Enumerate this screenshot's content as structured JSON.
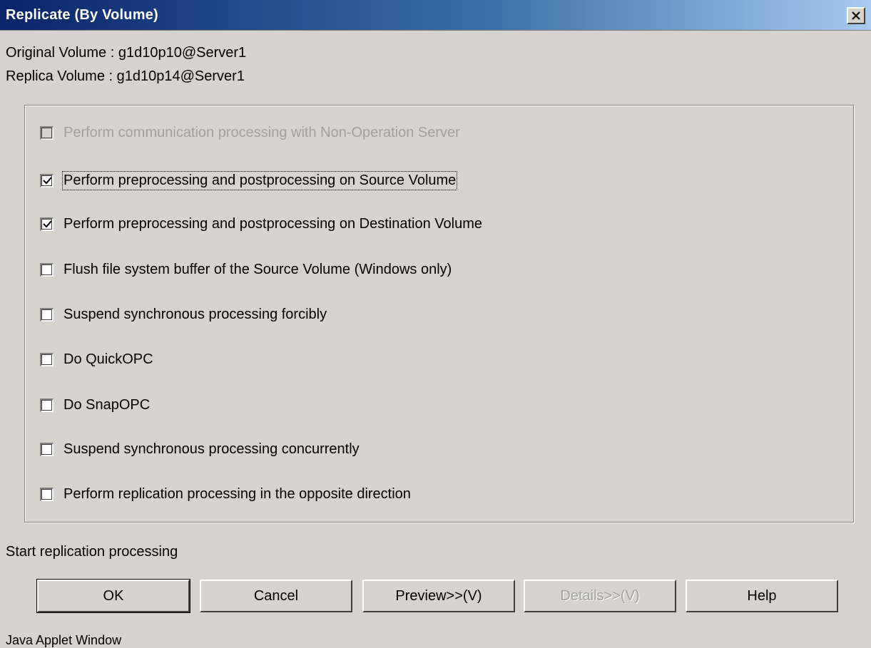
{
  "window": {
    "title": "Replicate (By Volume)",
    "close_icon": "close-icon",
    "original_volume": "Original Volume : g1d10p10@Server1",
    "replica_volume": "Replica Volume : g1d10p14@Server1"
  },
  "options": [
    {
      "label": "Perform communication processing with Non-Operation Server",
      "checked": false,
      "enabled": false
    },
    {
      "label": "Perform preprocessing and postprocessing on Source Volume",
      "checked": true,
      "enabled": true,
      "focused": true
    },
    {
      "label": "Perform preprocessing and postprocessing on Destination Volume",
      "checked": true,
      "enabled": true
    },
    {
      "label": "Flush file system buffer of the Source Volume (Windows only)",
      "checked": false,
      "enabled": true
    },
    {
      "label": "Suspend synchronous processing forcibly",
      "checked": false,
      "enabled": true
    },
    {
      "label": "Do QuickOPC",
      "checked": false,
      "enabled": true
    },
    {
      "label": "Do SnapOPC",
      "checked": false,
      "enabled": true
    },
    {
      "label": "Suspend synchronous processing concurrently",
      "checked": false,
      "enabled": true
    },
    {
      "label": "Perform replication processing in the opposite direction",
      "checked": false,
      "enabled": true
    }
  ],
  "status_text": "Start replication processing",
  "buttons": {
    "ok": "OK",
    "cancel": "Cancel",
    "preview": "Preview>>(V)",
    "details": "Details>>(V)",
    "help": "Help"
  },
  "footer": "Java Applet Window",
  "colors": {
    "title_gradient_start": "#0a246a",
    "title_gradient_end": "#a6caf0",
    "dialog_bg": "#d6d3ce",
    "disabled_text": "#a0a0a0"
  }
}
